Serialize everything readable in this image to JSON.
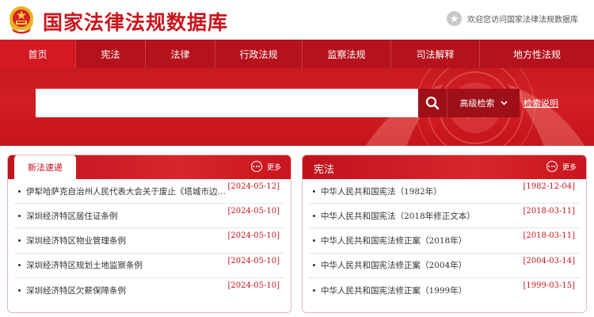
{
  "header": {
    "site_title": "国家法律法规数据库",
    "welcome": "欢迎您访问国家法律法规数据库"
  },
  "nav": {
    "items": [
      {
        "label": "首页",
        "active": true
      },
      {
        "label": "宪法"
      },
      {
        "label": "法律"
      },
      {
        "label": "行政法规"
      },
      {
        "label": "监察法规"
      },
      {
        "label": "司法解释"
      },
      {
        "label": "地方性法规"
      }
    ]
  },
  "search": {
    "value": "",
    "advanced_label": "高级检索",
    "help_label": "检索说明"
  },
  "panels": {
    "left": {
      "tab_label": "新法速递",
      "more_label": "更多",
      "items": [
        {
          "title": "伊犁哈萨克自治州人民代表大会关于废止《塔城市边境…",
          "date": "[2024-05-12]"
        },
        {
          "title": "深圳经济特区居住证条例",
          "date": "[2024-05-10]"
        },
        {
          "title": "深圳经济特区物业管理条例",
          "date": "[2024-05-10]"
        },
        {
          "title": "深圳经济特区规划土地监察条例",
          "date": "[2024-05-10]"
        },
        {
          "title": "深圳经济特区欠薪保障条例",
          "date": "[2024-05-10]"
        }
      ]
    },
    "right": {
      "title": "宪法",
      "more_label": "更多",
      "items": [
        {
          "title": "中华人民共和国宪法（1982年）",
          "date": "[1982-12-04]"
        },
        {
          "title": "中华人民共和国宪法（2018年修正文本）",
          "date": "[2018-03-11]"
        },
        {
          "title": "中华人民共和国宪法修正案（2018年）",
          "date": "[2018-03-11]"
        },
        {
          "title": "中华人民共和国宪法修正案（2004年）",
          "date": "[2004-03-14]"
        },
        {
          "title": "中华人民共和国宪法修正案（1999年）",
          "date": "[1999-03-15]"
        }
      ]
    }
  },
  "colors": {
    "brand_red": "#c8161d",
    "nav_red": "#b5121b",
    "active_nav": "#d31a22",
    "dark_red": "#9e0f17"
  }
}
